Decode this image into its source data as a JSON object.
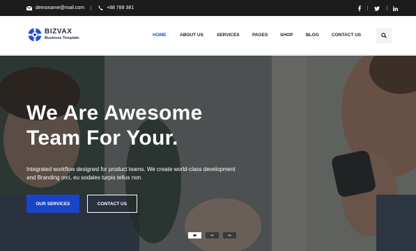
{
  "topbar": {
    "email": "demoname@mail.com",
    "phone": "+88 789 381",
    "social": [
      "f",
      "t",
      "in"
    ]
  },
  "header": {
    "brand_name": "BIZVAX",
    "brand_tagline": "Business Template",
    "nav": [
      "HOME",
      "ABOUT US",
      "SERVICES",
      "PAGES",
      "SHOP",
      "BLOG",
      "CONTACT US"
    ],
    "active_nav": "HOME"
  },
  "hero": {
    "title_line1": "We Are Awesome",
    "title_line2": "Team For Your.",
    "description": "Integrated workflow designed for product teams. We create world-class development and Branding orci, eu sodales turpis tellus non.",
    "primary_button": "OUR SERVICES",
    "secondary_button": "CONTACT US",
    "slides": 3,
    "active_slide": 1
  },
  "colors": {
    "topbar_bg": "#1c1c1c",
    "accent": "#1a44c8",
    "nav_active": "#1a4bd6",
    "text_dark": "#1c1c1c"
  },
  "icons": [
    "envelope-icon",
    "phone-icon",
    "facebook-icon",
    "twitter-icon",
    "linkedin-icon",
    "search-icon",
    "logo-icon"
  ]
}
